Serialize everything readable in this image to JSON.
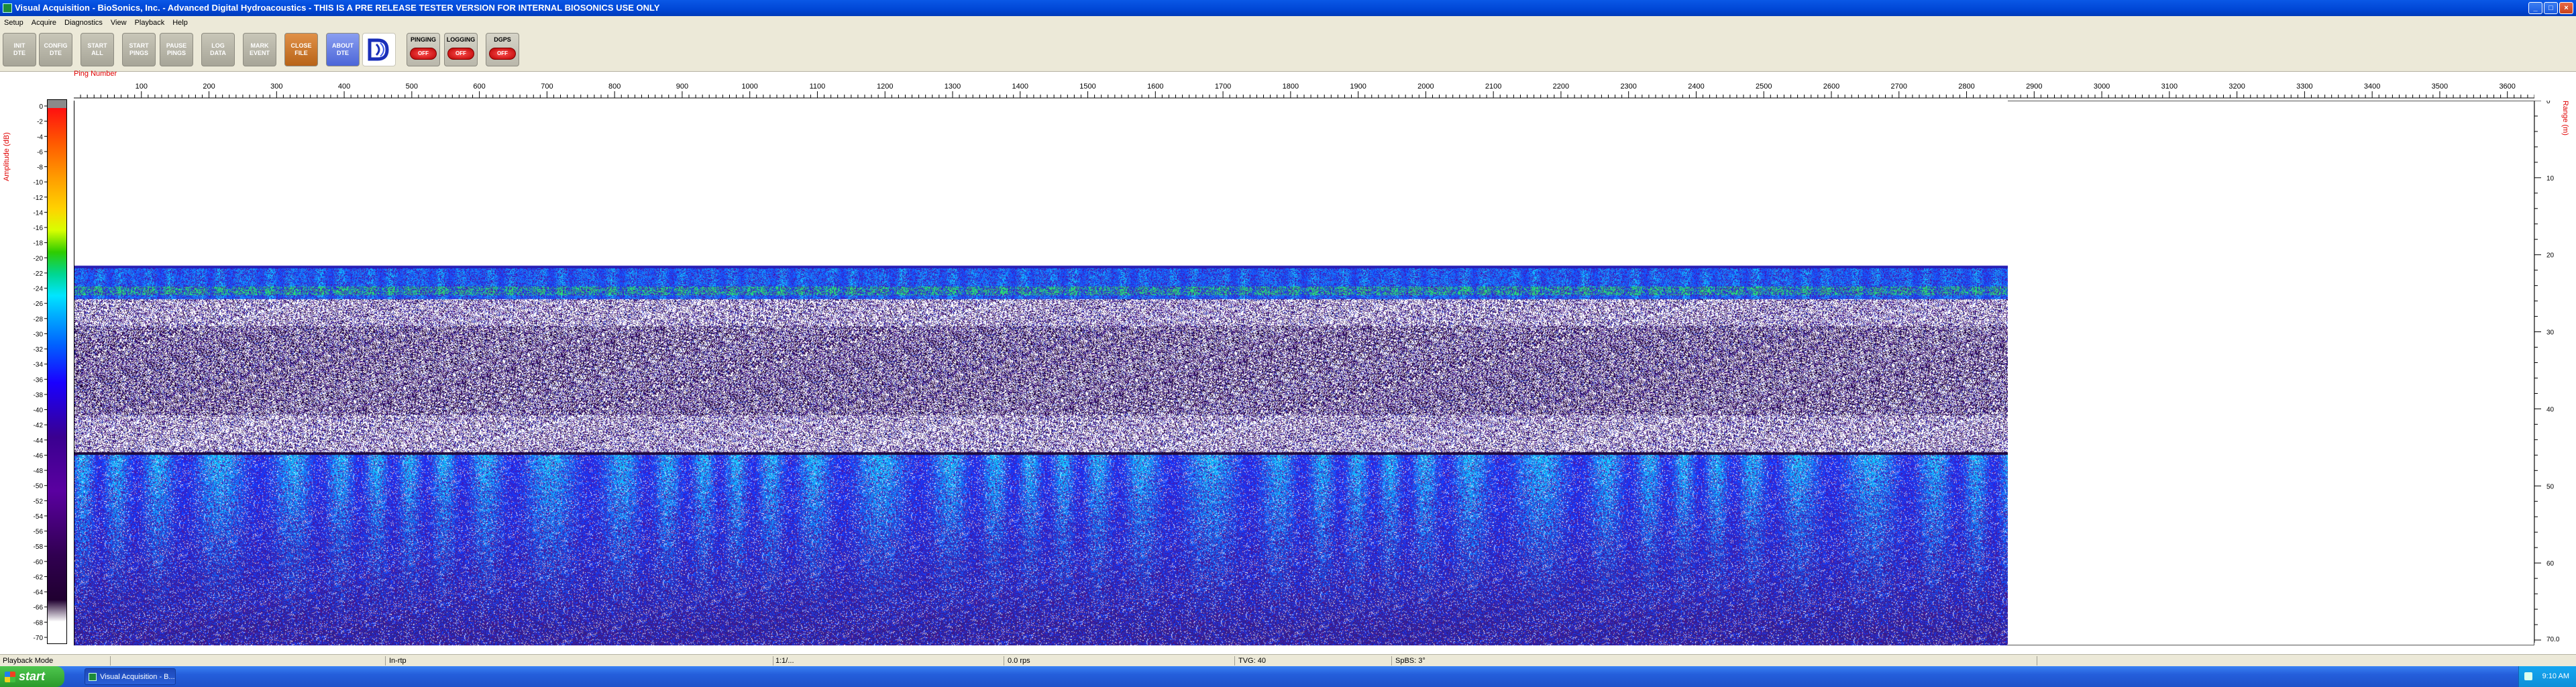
{
  "window": {
    "title": "Visual Acquisition  -  BioSonics, Inc.  -  Advanced Digital Hydroacoustics  -  THIS IS A PRE RELEASE TESTER VERSION FOR INTERNAL BIOSONICS USE ONLY",
    "minimize": "_",
    "maximize": "□",
    "close": "×"
  },
  "menu": [
    "Setup",
    "Acquire",
    "Diagnostics",
    "View",
    "Playback",
    "Help"
  ],
  "toolbar": {
    "init_dte": "INIT\nDTE",
    "config_dte": "CONFIG\nDTE",
    "start_all": "START\nALL",
    "start_pings": "START\nPINGS",
    "pause_pings": "PAUSE\nPINGS",
    "log_data": "LOG\nDATA",
    "mark_event": "MARK\nEVENT",
    "close_file": "CLOSE\nFILE",
    "about_dte": "ABOUT\nDTE",
    "logo": "BioSonics logo",
    "pinging_label": "PINGING",
    "pinging_state": "OFF",
    "logging_label": "LOGGING",
    "logging_state": "OFF",
    "dgps_label": "DGPS",
    "dgps_state": "OFF"
  },
  "echogram": {
    "x_axis_label": "Ping Number",
    "x_ticks": [
      100,
      200,
      300,
      400,
      500,
      600,
      700,
      800,
      900,
      1000,
      1100,
      1200,
      1300,
      1400,
      1500,
      1600,
      1700,
      1800,
      1900,
      2000,
      2100,
      2200,
      2300,
      2400,
      2500,
      2600,
      2700,
      2800,
      2900,
      3000,
      3100,
      3200,
      3300,
      3400,
      3500,
      3600
    ],
    "x_max": 3640,
    "data_end_ping": 2880,
    "y_left_label": "Amplitude (dB)",
    "y_left_ticks": [
      0,
      -2,
      -4,
      -6,
      -8,
      -10,
      -12,
      -14,
      -16,
      -18,
      -20,
      -22,
      -24,
      -26,
      -28,
      -30,
      -32,
      -34,
      -36,
      -38,
      -40,
      -42,
      -44,
      -46,
      -48,
      -50,
      -52,
      -54,
      -56,
      -58,
      -60,
      -62,
      -64,
      -66,
      -68,
      -70
    ],
    "y_right_label": "Range (m)",
    "y_right_ticks": [
      0,
      10,
      20,
      30,
      40,
      50,
      60
    ],
    "y_right_max_label": "70.0",
    "range_max": 70,
    "surface_range_m": 21.2,
    "bottom_range_m": 45.5,
    "colors": {
      "surface_blue": "#1e40ff",
      "bright_green": "#2ee07a",
      "purple": "#3c0e8a",
      "dark_purple": "#2a0050",
      "white_noise": "#ffffff"
    }
  },
  "status": {
    "mode": "Playback Mode",
    "field2": "In-rtp",
    "field3": "1:1/...",
    "field4": "0.0 rps",
    "field5": "TVG: 40",
    "field6": "SpBS: 3°"
  },
  "taskbar": {
    "start": "start",
    "task": "Visual Acquisition  -  B...",
    "clock": "9:10 AM"
  }
}
